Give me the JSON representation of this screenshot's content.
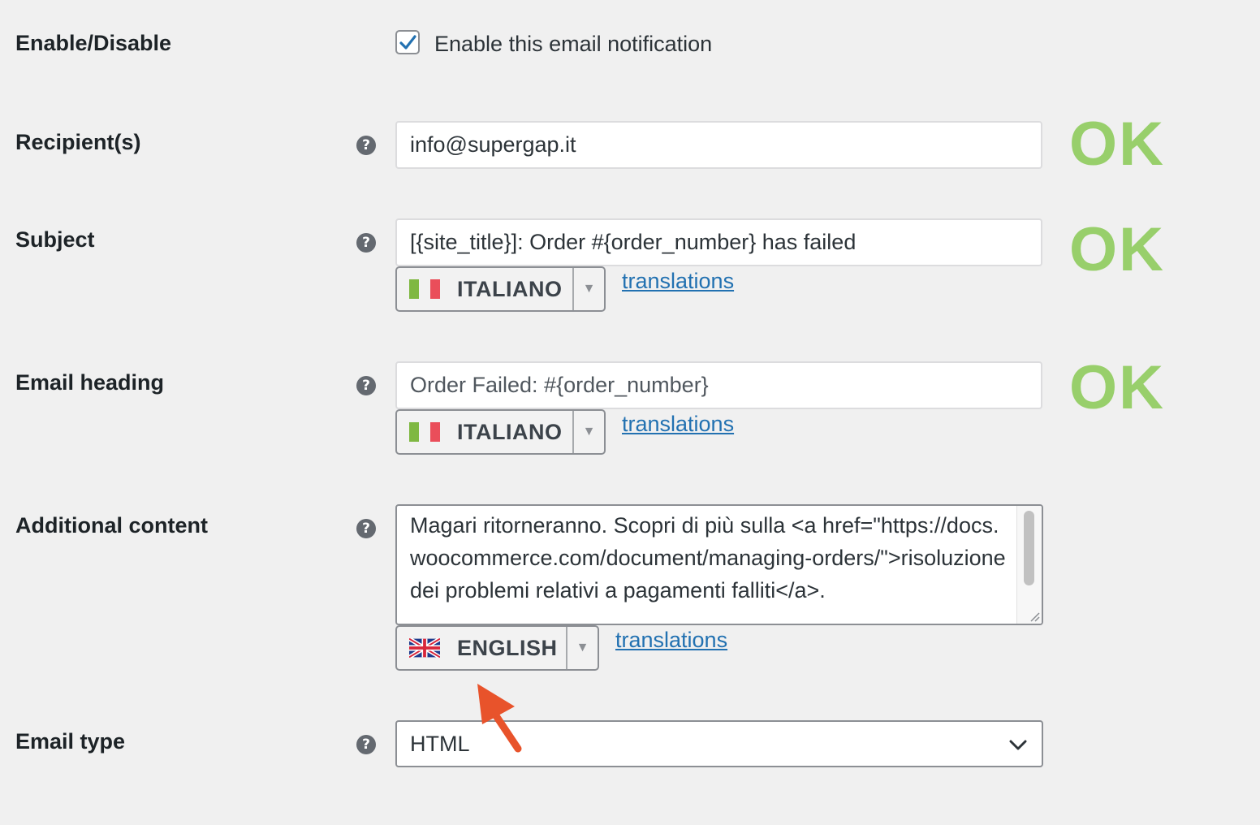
{
  "enable_disable": {
    "label": "Enable/Disable",
    "checkbox_label": "Enable this email notification",
    "checked": true
  },
  "recipients": {
    "label": "Recipient(s)",
    "value": "info@supergap.it",
    "status": "OK"
  },
  "subject": {
    "label": "Subject",
    "value": "[{site_title}]: Order #{order_number} has failed",
    "status": "OK",
    "language": "ITALIANO",
    "translations_link": "translations"
  },
  "email_heading": {
    "label": "Email heading",
    "placeholder": "Order Failed: #{order_number}",
    "status": "OK",
    "language": "ITALIANO",
    "translations_link": "translations"
  },
  "additional_content": {
    "label": "Additional content",
    "value": "Magari ritorneranno. Scopri di più sulla <a href=\"https://docs.woocommerce.com/document/managing-orders/\">risoluzione dei problemi relativi a pagamenti falliti</a>.",
    "language": "ENGLISH",
    "translations_link": "translations"
  },
  "email_type": {
    "label": "Email type",
    "selected": "HTML"
  },
  "help_icon_glyph": "?",
  "colors": {
    "ok_green": "#98cf6b",
    "link_blue": "#2271b1",
    "annotation_arrow": "#e8532b"
  },
  "icons": {
    "help": "question-circle-icon",
    "flag_it": "italy-flag-icon",
    "flag_en": "uk-flag-icon",
    "caret": "caret-down-icon",
    "chevron": "chevron-down-icon",
    "annotation": "red-arrow-icon"
  }
}
